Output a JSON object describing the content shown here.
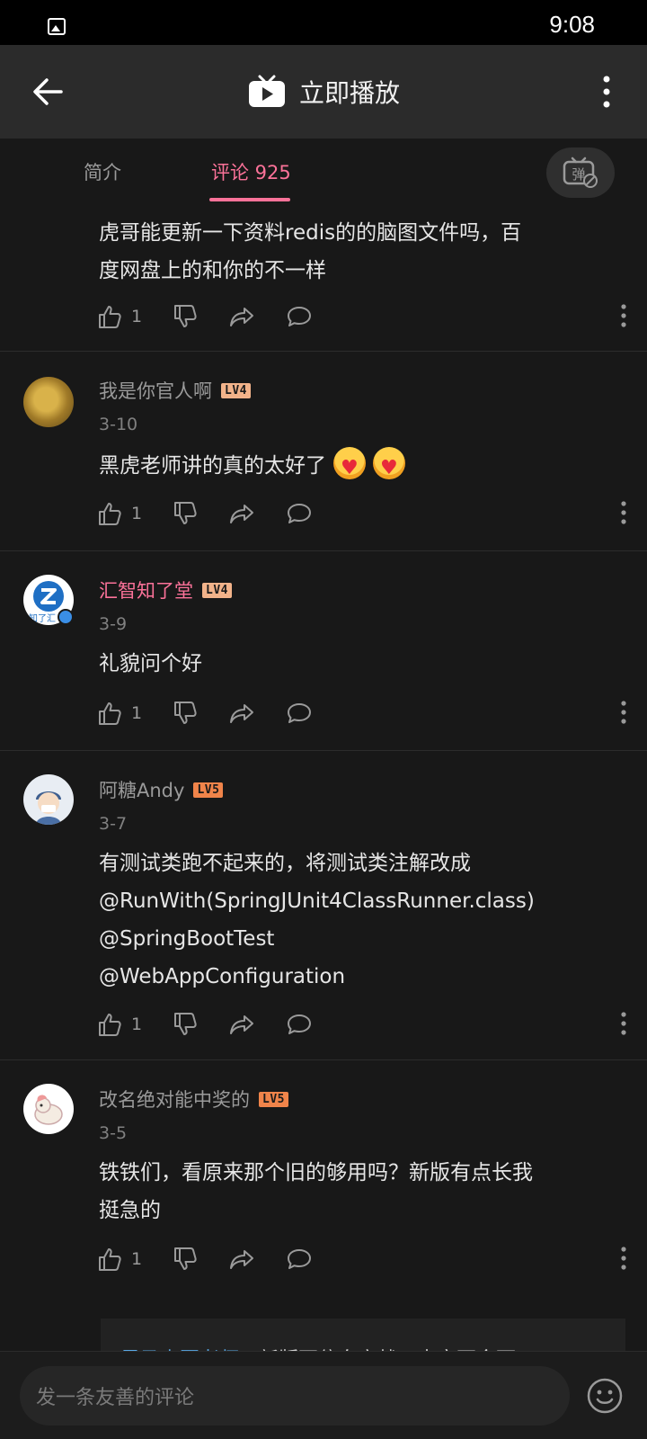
{
  "status_bar": {
    "time": "9:08"
  },
  "header": {
    "title": "立即播放"
  },
  "tabs": {
    "intro": "简介",
    "comments": "评论 925"
  },
  "comments": [
    {
      "text_lines": [
        "虎哥能更新一下资料redis的的脑图文件吗，百",
        "度网盘上的和你的不一样"
      ],
      "likes": "1"
    },
    {
      "username": "我是你官人啊",
      "level": "LV4",
      "date": "3-10",
      "text": "黑虎老师讲的真的太好了",
      "likes": "1"
    },
    {
      "username": "汇智知了堂",
      "level": "LV4",
      "date": "3-9",
      "text": "礼貌问个好",
      "likes": "1",
      "avatar_text": "知了汇"
    },
    {
      "username": "阿糖Andy",
      "level": "LV5",
      "date": "3-7",
      "text_lines": [
        "有测试类跑不起来的，将测试类注解改成",
        "@RunWith(SpringJUnit4ClassRunner.class)",
        "@SpringBootTest",
        "@WebAppConfiguration"
      ],
      "likes": "1"
    },
    {
      "username": "改名绝对能中奖的",
      "level": "LV5",
      "date": "3-5",
      "text_lines": [
        "铁铁们，看原来那个旧的够用吗？新版有点长我",
        "挺急的"
      ],
      "likes": "1"
    }
  ],
  "reply_preview": {
    "name": "黑马虎哥老师:",
    "text": "新版更偏向实战，内容更全面"
  },
  "bottom": {
    "placeholder": "发一条友善的评论"
  },
  "colors": {
    "accent": "#fb7299",
    "background": "#181818",
    "header_bg": "#2b2b2b"
  }
}
